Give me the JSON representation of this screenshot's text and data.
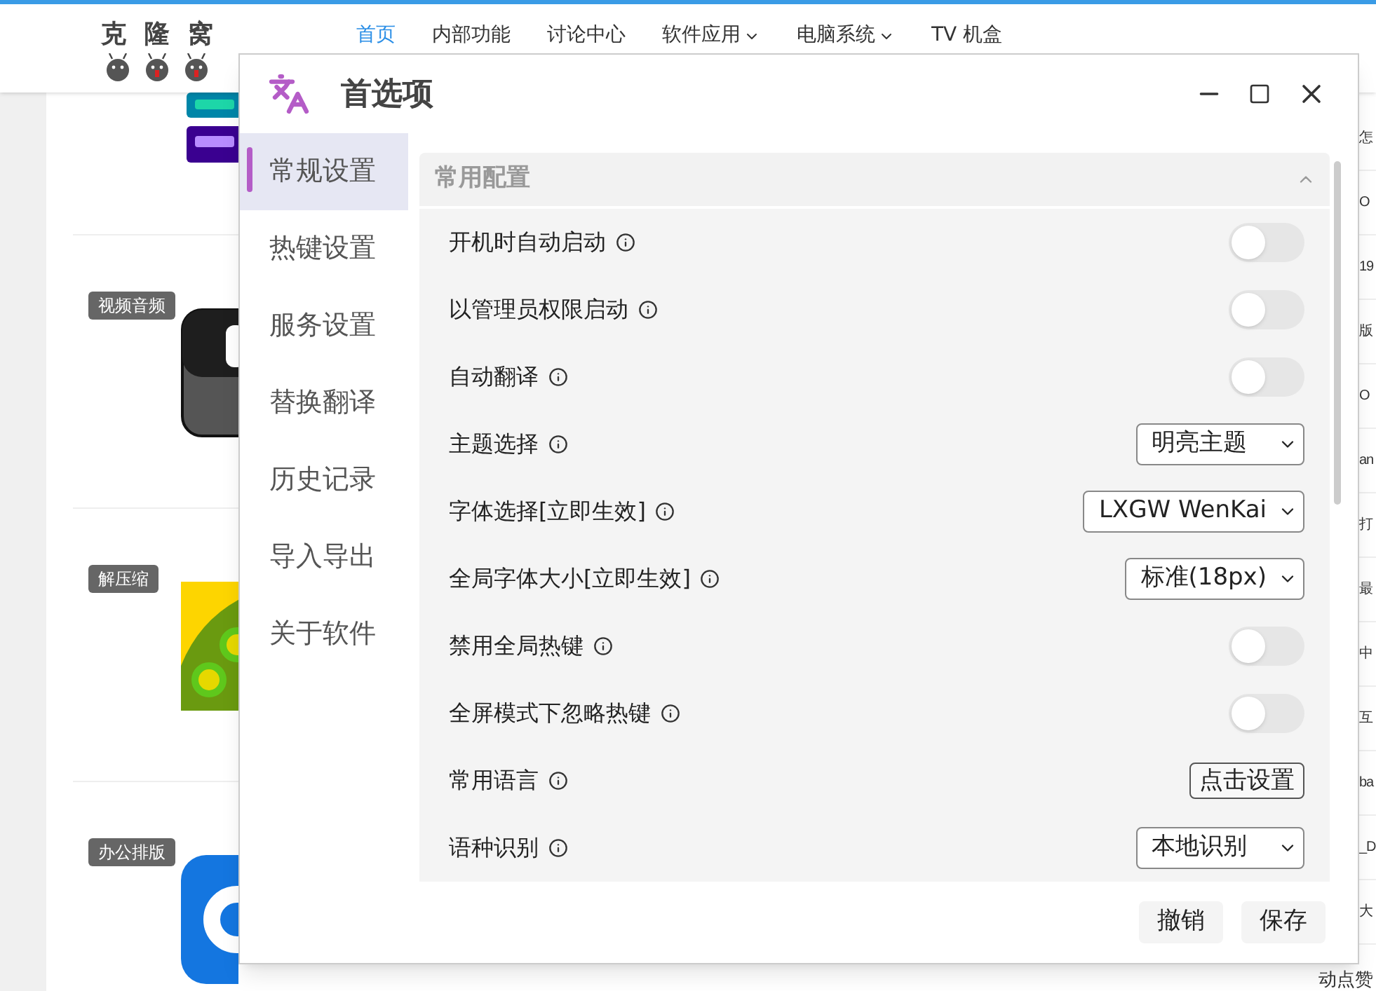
{
  "site": {
    "logo": [
      "克",
      "隆",
      "窝"
    ],
    "nav": [
      {
        "label": "首页",
        "selected": true,
        "dropdown": false
      },
      {
        "label": "内部功能",
        "selected": false,
        "dropdown": false
      },
      {
        "label": "讨论中心",
        "selected": false,
        "dropdown": false
      },
      {
        "label": "软件应用",
        "selected": false,
        "dropdown": true
      },
      {
        "label": "电脑系统",
        "selected": false,
        "dropdown": true
      },
      {
        "label": "TV 机盒",
        "selected": false,
        "dropdown": false
      }
    ],
    "categories": [
      {
        "kind": "bars"
      },
      {
        "tag": "视频音频",
        "kind": "video"
      },
      {
        "tag": "解压缩",
        "kind": "zip"
      },
      {
        "tag": "办公排版",
        "kind": "office"
      }
    ],
    "side_fragments": [
      "怎",
      "O",
      "19",
      "版",
      "O",
      "an",
      "打",
      "最",
      "中",
      "互",
      "ba",
      "_D",
      "大"
    ],
    "bottom_fragment": "动点赞"
  },
  "dialog": {
    "title": "首选项",
    "nav": [
      {
        "label": "常规设置",
        "selected": true
      },
      {
        "label": "热键设置",
        "selected": false
      },
      {
        "label": "服务设置",
        "selected": false
      },
      {
        "label": "替换翻译",
        "selected": false
      },
      {
        "label": "历史记录",
        "selected": false
      },
      {
        "label": "导入导出",
        "selected": false
      },
      {
        "label": "关于软件",
        "selected": false
      }
    ],
    "section": {
      "title": "常用配置",
      "expanded": true
    },
    "settings": [
      {
        "label": "开机时自动启动",
        "kind": "toggle",
        "on": false
      },
      {
        "label": "以管理员权限启动",
        "kind": "toggle",
        "on": false
      },
      {
        "label": "自动翻译",
        "kind": "toggle",
        "on": false
      },
      {
        "label": "主题选择",
        "kind": "select",
        "value": "明亮主题"
      },
      {
        "label": "字体选择[立即生效]",
        "kind": "select",
        "value": "LXGW WenKai"
      },
      {
        "label": "全局字体大小[立即生效]",
        "kind": "select",
        "value": "标准(18px)"
      },
      {
        "label": "禁用全局热键",
        "kind": "toggle",
        "on": false
      },
      {
        "label": "全屏模式下忽略热键",
        "kind": "toggle",
        "on": false
      },
      {
        "label": "常用语言",
        "kind": "button",
        "value": "点击设置"
      },
      {
        "label": "语种识别",
        "kind": "select",
        "value": "本地识别"
      }
    ],
    "buttons": [
      "撤销",
      "保存"
    ]
  }
}
